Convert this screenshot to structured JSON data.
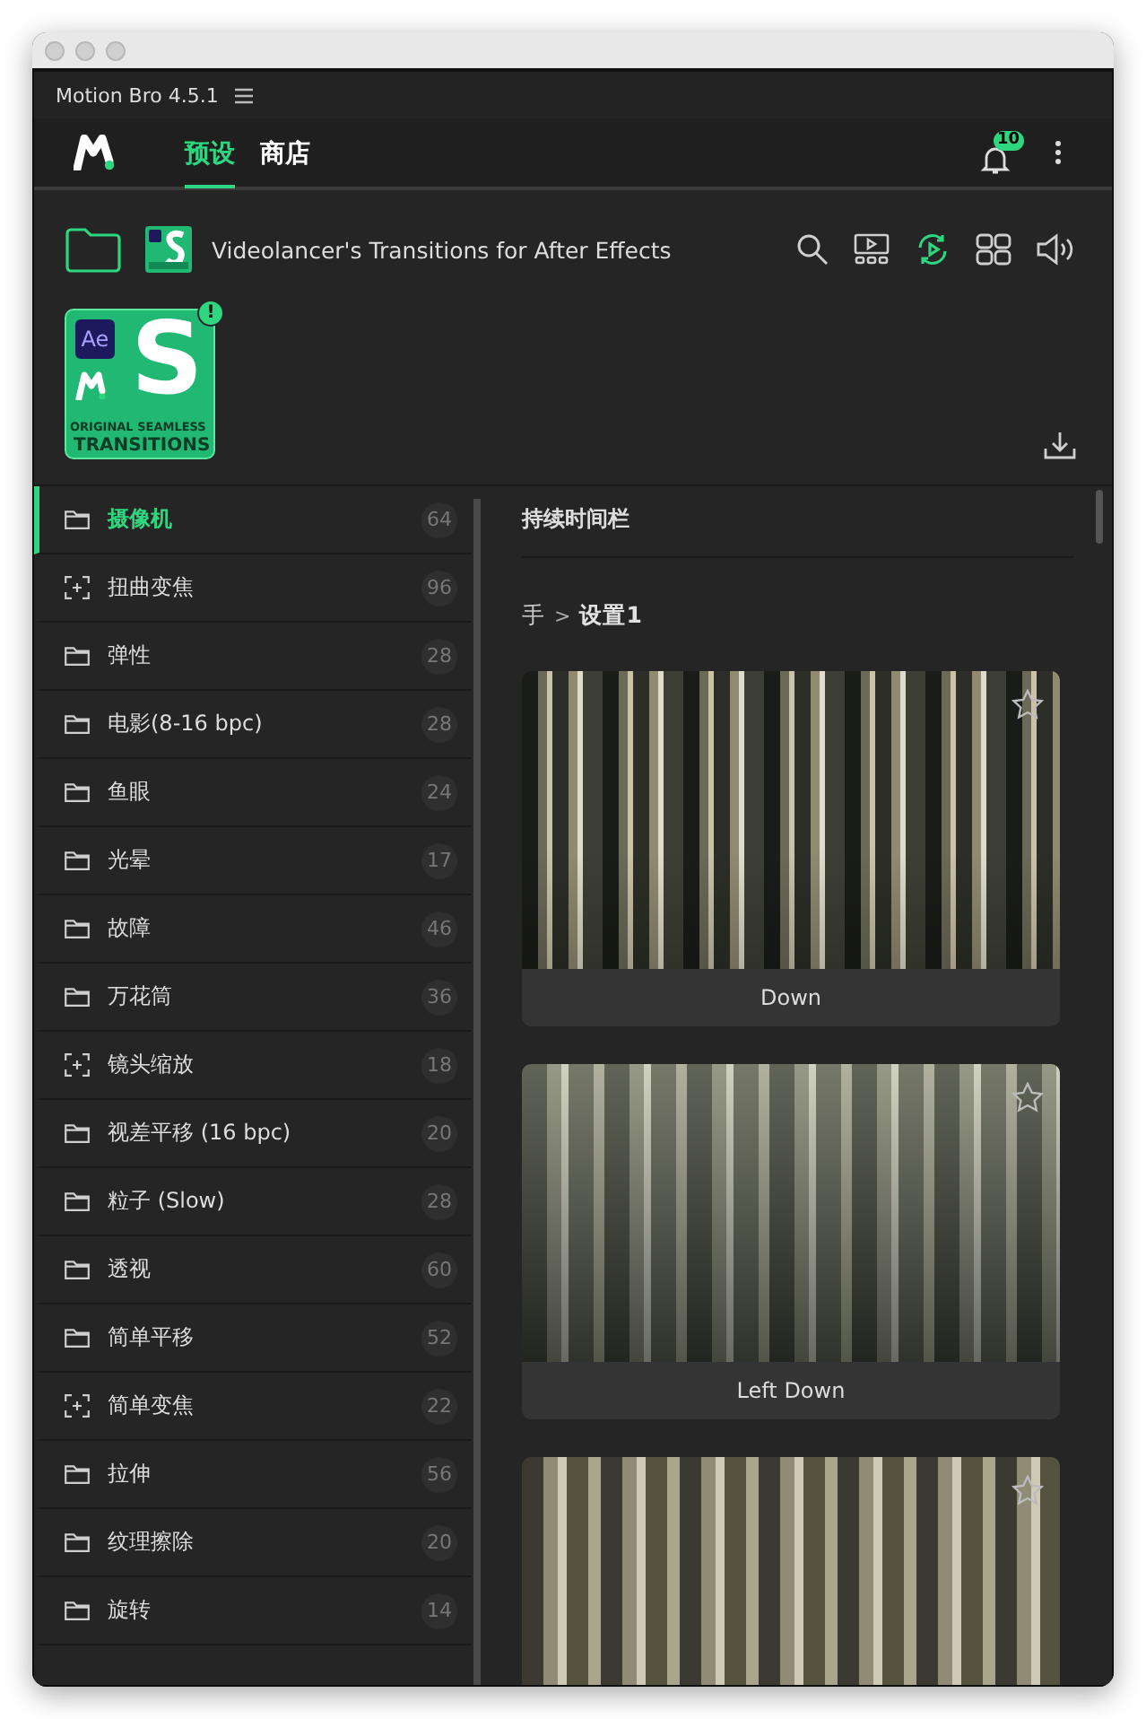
{
  "window": {
    "title": "Motion Bro 4.5.1"
  },
  "nav": {
    "tabs": [
      {
        "label": "预设",
        "selected": true
      },
      {
        "label": "商店",
        "selected": false
      }
    ],
    "notifications": "10"
  },
  "product": {
    "title": "Videolancer's Transitions for After Effects",
    "toolbar": [
      {
        "kind": "search",
        "on": false
      },
      {
        "kind": "preview",
        "on": false
      },
      {
        "kind": "autoplay",
        "on": true
      },
      {
        "kind": "grid",
        "on": false
      },
      {
        "kind": "sound",
        "on": false
      }
    ],
    "cover": {
      "badge": "Ae",
      "letter": "S",
      "line1": "ORIGINAL SEAMLESS",
      "line2": "TRANSITIONS",
      "alert": "!"
    }
  },
  "sidebar": {
    "items": [
      {
        "kind": "folder",
        "label": "摄像机",
        "count": "64",
        "selected": true
      },
      {
        "kind": "zoom",
        "label": "扭曲变焦",
        "count": "96",
        "selected": false
      },
      {
        "kind": "folder",
        "label": "弹性",
        "count": "28",
        "selected": false
      },
      {
        "kind": "folder",
        "label": "电影(8-16 bpc)",
        "count": "28",
        "selected": false
      },
      {
        "kind": "folder",
        "label": "鱼眼",
        "count": "24",
        "selected": false
      },
      {
        "kind": "folder",
        "label": "光晕",
        "count": "17",
        "selected": false
      },
      {
        "kind": "folder",
        "label": "故障",
        "count": "46",
        "selected": false
      },
      {
        "kind": "folder",
        "label": "万花筒",
        "count": "36",
        "selected": false
      },
      {
        "kind": "zoom",
        "label": "镜头缩放",
        "count": "18",
        "selected": false
      },
      {
        "kind": "folder",
        "label": "视差平移 (16 bpc)",
        "count": "20",
        "selected": false
      },
      {
        "kind": "folder",
        "label": "粒子 (Slow)",
        "count": "28",
        "selected": false
      },
      {
        "kind": "folder",
        "label": "透视",
        "count": "60",
        "selected": false
      },
      {
        "kind": "folder",
        "label": "简单平移",
        "count": "52",
        "selected": false
      },
      {
        "kind": "zoom",
        "label": "简单变焦",
        "count": "22",
        "selected": false
      },
      {
        "kind": "folder",
        "label": "拉伸",
        "count": "56",
        "selected": false
      },
      {
        "kind": "folder",
        "label": "纹理擦除",
        "count": "20",
        "selected": false
      },
      {
        "kind": "folder",
        "label": "旋转",
        "count": "14",
        "selected": false
      }
    ]
  },
  "content": {
    "heading": "持续时间栏",
    "breadcrumb": [
      {
        "text": "手",
        "current": false
      },
      {
        "text": "设置1",
        "current": true
      }
    ],
    "separator": ">",
    "presets": [
      {
        "name": "Down",
        "starred": false
      },
      {
        "name": "Left Down",
        "starred": false
      },
      {
        "starred": false
      }
    ]
  }
}
